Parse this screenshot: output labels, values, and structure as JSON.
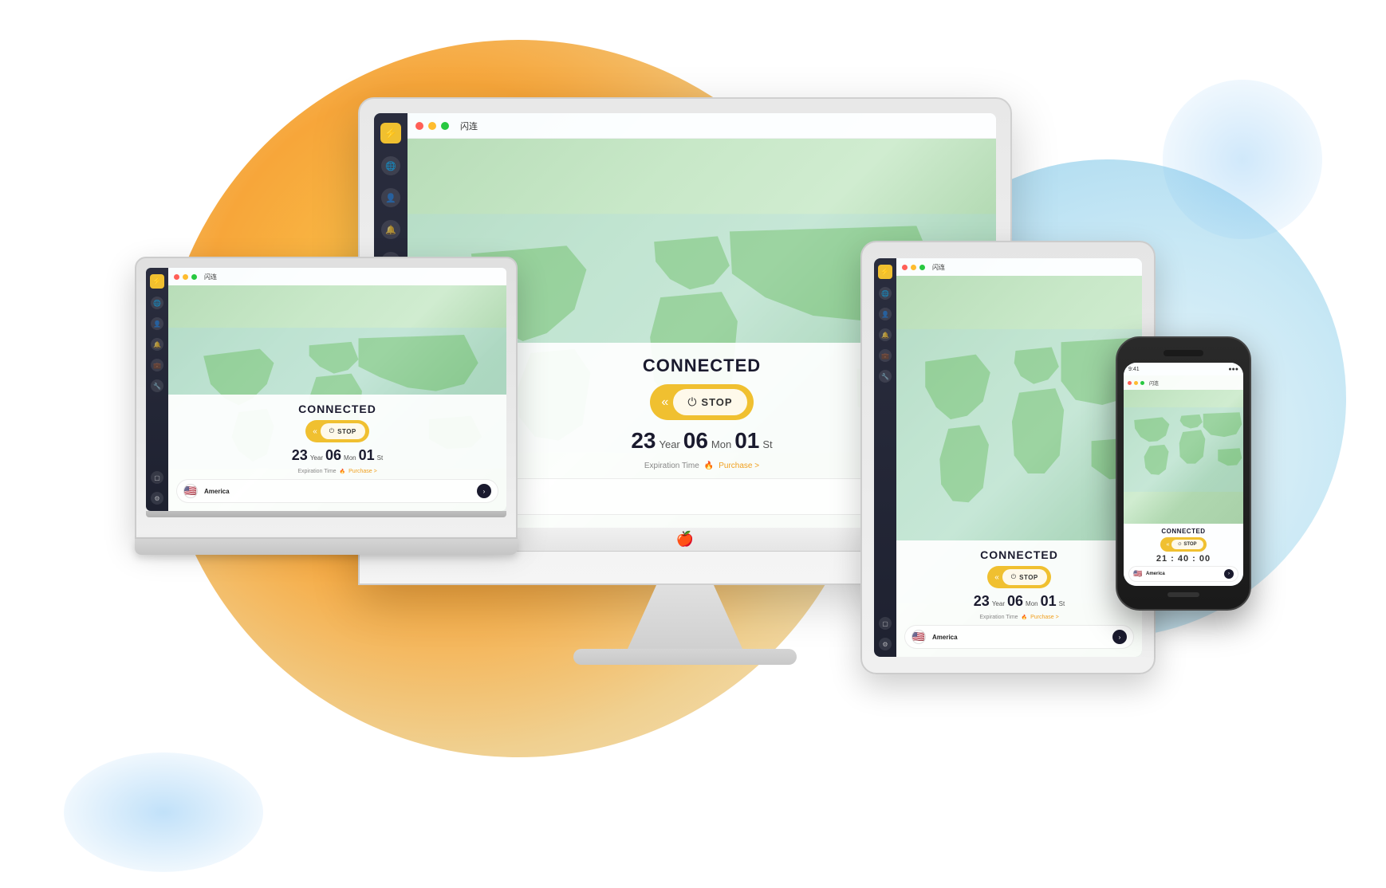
{
  "app": {
    "title": "闪连",
    "status": "CONNECTED",
    "stop_label": "STOP",
    "expiry_label": "Expiration Time",
    "purchase_label": "Purchase >",
    "date": {
      "year_num": "23",
      "year_unit": "Year",
      "month_num": "06",
      "month_unit": "Mon",
      "day_num": "01",
      "day_unit": "St"
    },
    "country": "America",
    "timer": "21 : 40 : 00",
    "window_dots": [
      "red",
      "yellow",
      "green"
    ]
  },
  "icons": {
    "logo": "⚡",
    "globe": "🌐",
    "user": "👤",
    "bell": "🔔",
    "briefcase": "💼",
    "wrench": "🔧",
    "square": "⬜",
    "gear": "⚙",
    "power": "⏻",
    "chevron_left": "«",
    "arrow_right": "›",
    "flag_us": "🇺🇸"
  },
  "colors": {
    "accent": "#f0c030",
    "dark_sidebar": "#2a2d3e",
    "connected_green": "#28c840",
    "text_dark": "#1a1a2e",
    "purchase_orange": "#f0a020"
  }
}
